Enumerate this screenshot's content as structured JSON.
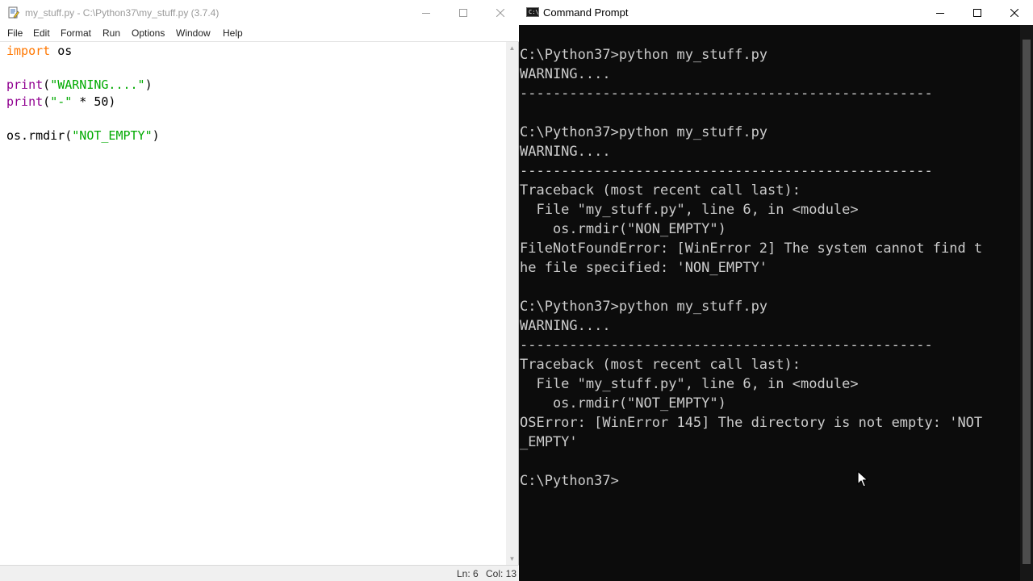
{
  "idle": {
    "title": "my_stuff.py - C:\\Python37\\my_stuff.py (3.7.4)",
    "menu": [
      "File",
      "Edit",
      "Format",
      "Run",
      "Options",
      "Window",
      "Help"
    ],
    "code": {
      "line1": {
        "kw": "import",
        "rest": " os"
      },
      "line3": {
        "bi": "print",
        "open": "(",
        "str": "\"WARNING....\"",
        "close": ")"
      },
      "line4": {
        "bi": "print",
        "open": "(",
        "str": "\"-\"",
        "rest": " * 50)"
      },
      "line6": {
        "pre": "os.rmdir(",
        "str": "\"NOT_EMPTY\"",
        "close": ")"
      }
    },
    "status": {
      "line": "Ln: 6",
      "col": "Col: 13"
    }
  },
  "cmd": {
    "title": "Command Prompt",
    "icon_text": "C:\\",
    "lines": [
      "C:\\Python37>python my_stuff.py",
      "WARNING....",
      "--------------------------------------------------",
      "",
      "C:\\Python37>python my_stuff.py",
      "WARNING....",
      "--------------------------------------------------",
      "Traceback (most recent call last):",
      "  File \"my_stuff.py\", line 6, in <module>",
      "    os.rmdir(\"NON_EMPTY\")",
      "FileNotFoundError: [WinError 2] The system cannot find t",
      "he file specified: 'NON_EMPTY'",
      "",
      "C:\\Python37>python my_stuff.py",
      "WARNING....",
      "--------------------------------------------------",
      "Traceback (most recent call last):",
      "  File \"my_stuff.py\", line 6, in <module>",
      "    os.rmdir(\"NOT_EMPTY\")",
      "OSError: [WinError 145] The directory is not empty: 'NOT",
      "_EMPTY'",
      "",
      "C:\\Python37>"
    ]
  },
  "icons": {
    "idle_app": "idle-file-icon",
    "cmd_app": "command-prompt-icon",
    "minimize": "minimize-icon",
    "maximize": "maximize-icon",
    "close": "close-icon",
    "mouse": "mouse-cursor-icon"
  }
}
